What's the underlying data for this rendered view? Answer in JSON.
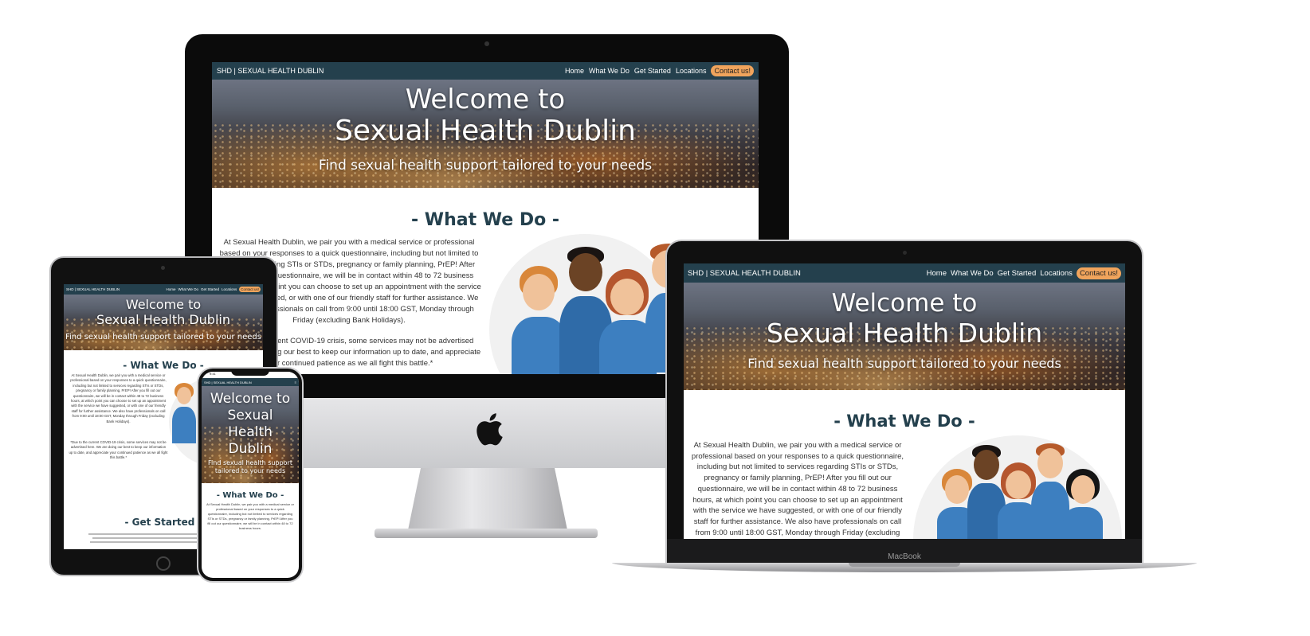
{
  "site": {
    "brand": "SHD | SEXUAL HEALTH DUBLIN",
    "nav": [
      "Home",
      "What We Do",
      "Get Started",
      "Locations"
    ],
    "contact_label": "Contact us!",
    "hero_line1": "Welcome to",
    "hero_line2": "Sexual Health Dublin",
    "hero_sub": "Find sexual health support tailored to your needs",
    "section_title": "- What We Do -",
    "section2_title": "- Get Started -",
    "para1": "At Sexual Health Dublin, we pair you with a medical service or professional based on your responses to a quick questionnaire, including but not limited to services regarding STIs or STDs, pregnancy or family planning, PrEP! After you fill out our questionnaire, we will be in contact within 48 to 72 business hours, at which point you can choose to set up an appointment with the service we have suggested, or with one of our friendly staff for further assistance. We also have professionals on call from 9:00 until 18:00 GST, Monday through Friday (excluding Bank Holidays).",
    "para2": "*Due to the current COVID-19 crisis, some services may not be advertised here. We are doing our best to keep our information up to date, and appreciate your continued patience as we all fight this battle.*",
    "para1_phone": "At Sexual Health Dublin, we pair you with a medical service or professional based on your responses to a quick questionnaire, including but not limited to services regarding STIs or STDs, pregnancy or family planning, PrEP! After you fill out our questionnaire, we will be in contact within 48 to 72 business hours."
  },
  "devices": {
    "macbook_label": "MacBook",
    "phone_time": "9:41"
  },
  "colors": {
    "nav": "#24404d",
    "contact": "#f0a45c",
    "title": "#24404d",
    "scrubs": "#3d7fc0"
  }
}
